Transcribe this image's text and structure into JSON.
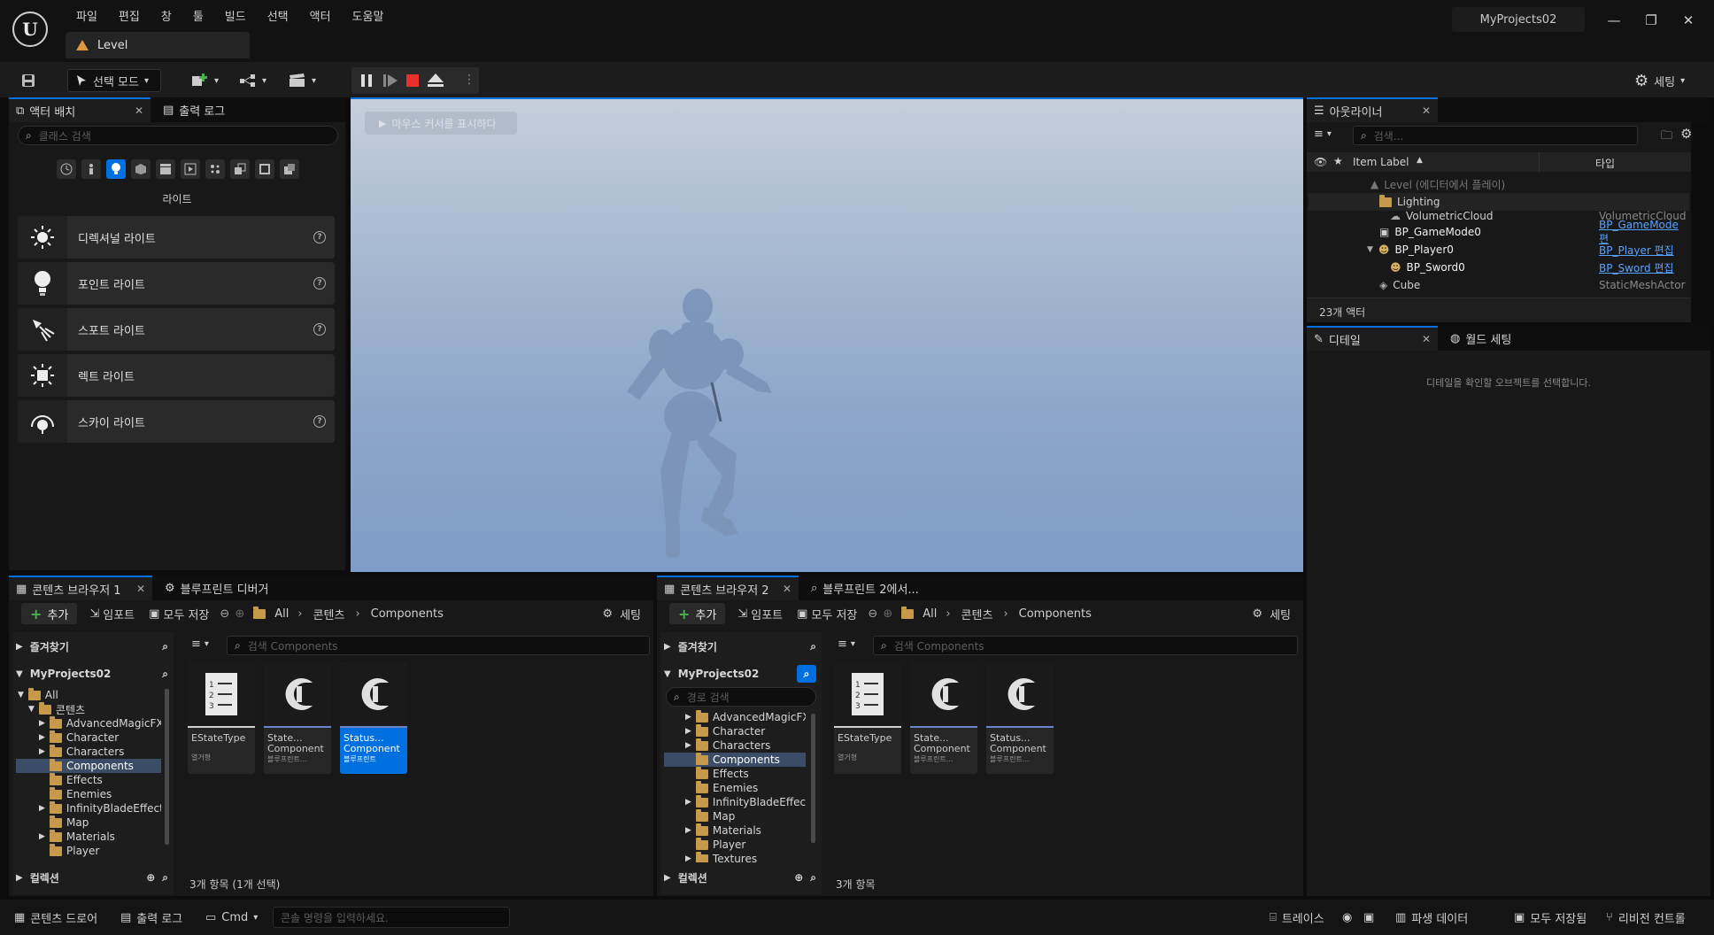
{
  "menu": [
    "파일",
    "편집",
    "창",
    "툴",
    "빌드",
    "선택",
    "액터",
    "도움말"
  ],
  "level_tab": "Level",
  "project_name": "MyProjects02",
  "toolbar": {
    "select_mode": "선택 모드",
    "settings": "세팅"
  },
  "place_actors": {
    "tab": "액터 배치",
    "output_tab": "출력 로그",
    "search_placeholder": "클래스 검색",
    "category": "라이트",
    "items": [
      "디렉셔널 라이트",
      "포인트 라이트",
      "스포트 라이트",
      "렉트 라이트",
      "스카이 라이트"
    ]
  },
  "viewport": {
    "hint": "마우스 커서를 표시하다"
  },
  "outliner": {
    "tab": "아웃라이너",
    "search_placeholder": "검색...",
    "col_label": "Item Label",
    "col_type": "타입",
    "rows": [
      {
        "label": "Level (에디터에서 플레이)",
        "type": ""
      },
      {
        "label": "Lighting",
        "type": ""
      },
      {
        "label": "VolumetricCloud",
        "type": "VolumetricCloud"
      },
      {
        "label": "BP_GameMode0",
        "type": "BP_GameMode 편"
      },
      {
        "label": "BP_Player0",
        "type": "BP_Player 편집"
      },
      {
        "label": "BP_Sword0",
        "type": "BP_Sword 편집"
      },
      {
        "label": "Cube",
        "type": "StaticMeshActor"
      }
    ],
    "count": "23개 액터"
  },
  "details": {
    "tab": "디테일",
    "world_tab": "월드 세팅",
    "empty": "디테일을 확인할 오브젝트를 선택합니다."
  },
  "cb1": {
    "tab": "콘텐츠 브라우저 1",
    "tab2": "블루프린트 디버거",
    "add": "추가",
    "import": "임포트",
    "save_all": "모두 저장",
    "crumbs": [
      "All",
      "콘텐츠",
      "Components"
    ],
    "settings": "세팅",
    "favorites": "즐겨찾기",
    "project": "MyProjects02",
    "tree": [
      "All",
      "콘텐츠",
      "AdvancedMagicFX",
      "Character",
      "Characters",
      "Components",
      "Effects",
      "Enemies",
      "InfinityBladeEffects",
      "Map",
      "Materials",
      "Player"
    ],
    "collections": "컬렉션",
    "search_placeholder": "검색 Components",
    "assets": [
      {
        "name": "EStateType",
        "type": "열거형"
      },
      {
        "name": "State...\nComponent",
        "type": "블루프린트..."
      },
      {
        "name": "Status...\nComponent",
        "type": "블루프린트"
      }
    ],
    "count": "3개 항목 (1개 선택)"
  },
  "cb2": {
    "tab": "콘텐츠 브라우저 2",
    "tab2": "블루프린트 2에서...",
    "add": "추가",
    "import": "임포트",
    "save_all": "모두 저장",
    "crumbs": [
      "All",
      "콘텐츠",
      "Components"
    ],
    "settings": "세팅",
    "favorites": "즐겨찾기",
    "project": "MyProjects02",
    "path_placeholder": "경로 검색",
    "tree": [
      "AdvancedMagicFX",
      "Character",
      "Characters",
      "Components",
      "Effects",
      "Enemies",
      "InfinityBladeEffects",
      "Map",
      "Materials",
      "Player",
      "Textures"
    ],
    "collections": "컬렉션",
    "search_placeholder": "검색 Components",
    "assets": [
      {
        "name": "EStateType",
        "type": "열거형"
      },
      {
        "name": "State...\nComponent",
        "type": "블루프린트..."
      },
      {
        "name": "Status...\nComponent",
        "type": "블루프린트..."
      }
    ],
    "count": "3개 항목"
  },
  "statusbar": {
    "content_drawer": "콘텐츠 드로어",
    "output_log": "출력 로그",
    "cmd": "Cmd",
    "console_placeholder": "콘솔 명령을 입력하세요.",
    "trace": "트레이스",
    "derived_data": "파생 데이터",
    "all_saved": "모두 저장됨",
    "revision": "리비전 컨트롤"
  },
  "colors": {
    "accent": "#0070e0",
    "link": "#5aa2ff",
    "folder": "#c79a4b"
  }
}
